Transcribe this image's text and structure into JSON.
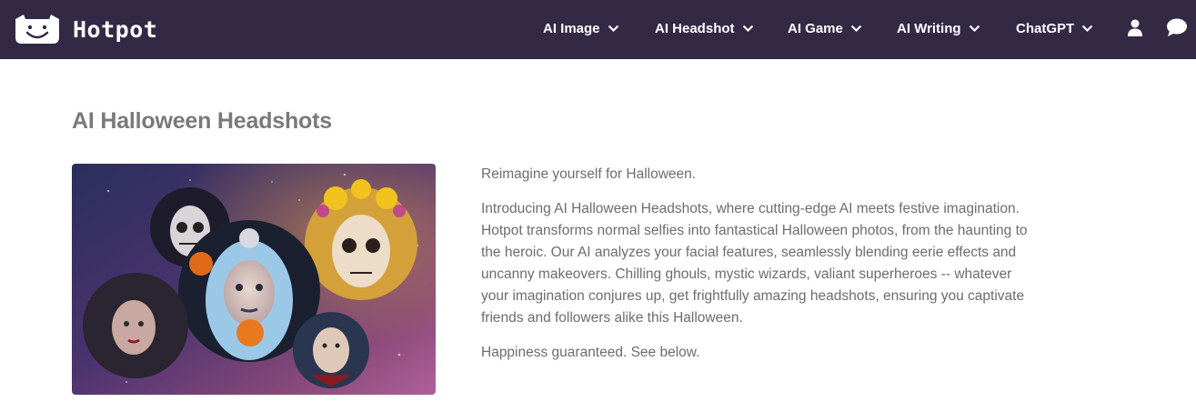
{
  "nav": {
    "brand": "Hotpot",
    "items": [
      {
        "label": "AI Image"
      },
      {
        "label": "AI Headshot"
      },
      {
        "label": "AI Game"
      },
      {
        "label": "AI Writing"
      },
      {
        "label": "ChatGPT"
      }
    ],
    "icons": [
      "user-icon",
      "chat-bubble-icon",
      "chevron-down-icon",
      "smiley-logo-icon"
    ]
  },
  "content": {
    "title": "AI Halloween Headshots",
    "paragraphs": [
      "Reimagine yourself for Halloween.",
      "Introducing AI Halloween Headshots, where cutting-edge AI meets festive imagination. Hotpot transforms normal selfies into fantastical Halloween photos, from the haunting to the heroic. Our AI analyzes your facial features, seamlessly blending eerie effects and uncanny makeovers. Chilling ghouls, mystic wizards, valiant superheroes -- whatever your imagination conjures up, get frightfully amazing headshots, ensuring you captivate friends and followers alike this Halloween.",
      "Happiness guaranteed. See below."
    ]
  },
  "colors": {
    "navbar": "#332944",
    "title": "#7a7a7a",
    "body_text": "#6d6d6d"
  }
}
